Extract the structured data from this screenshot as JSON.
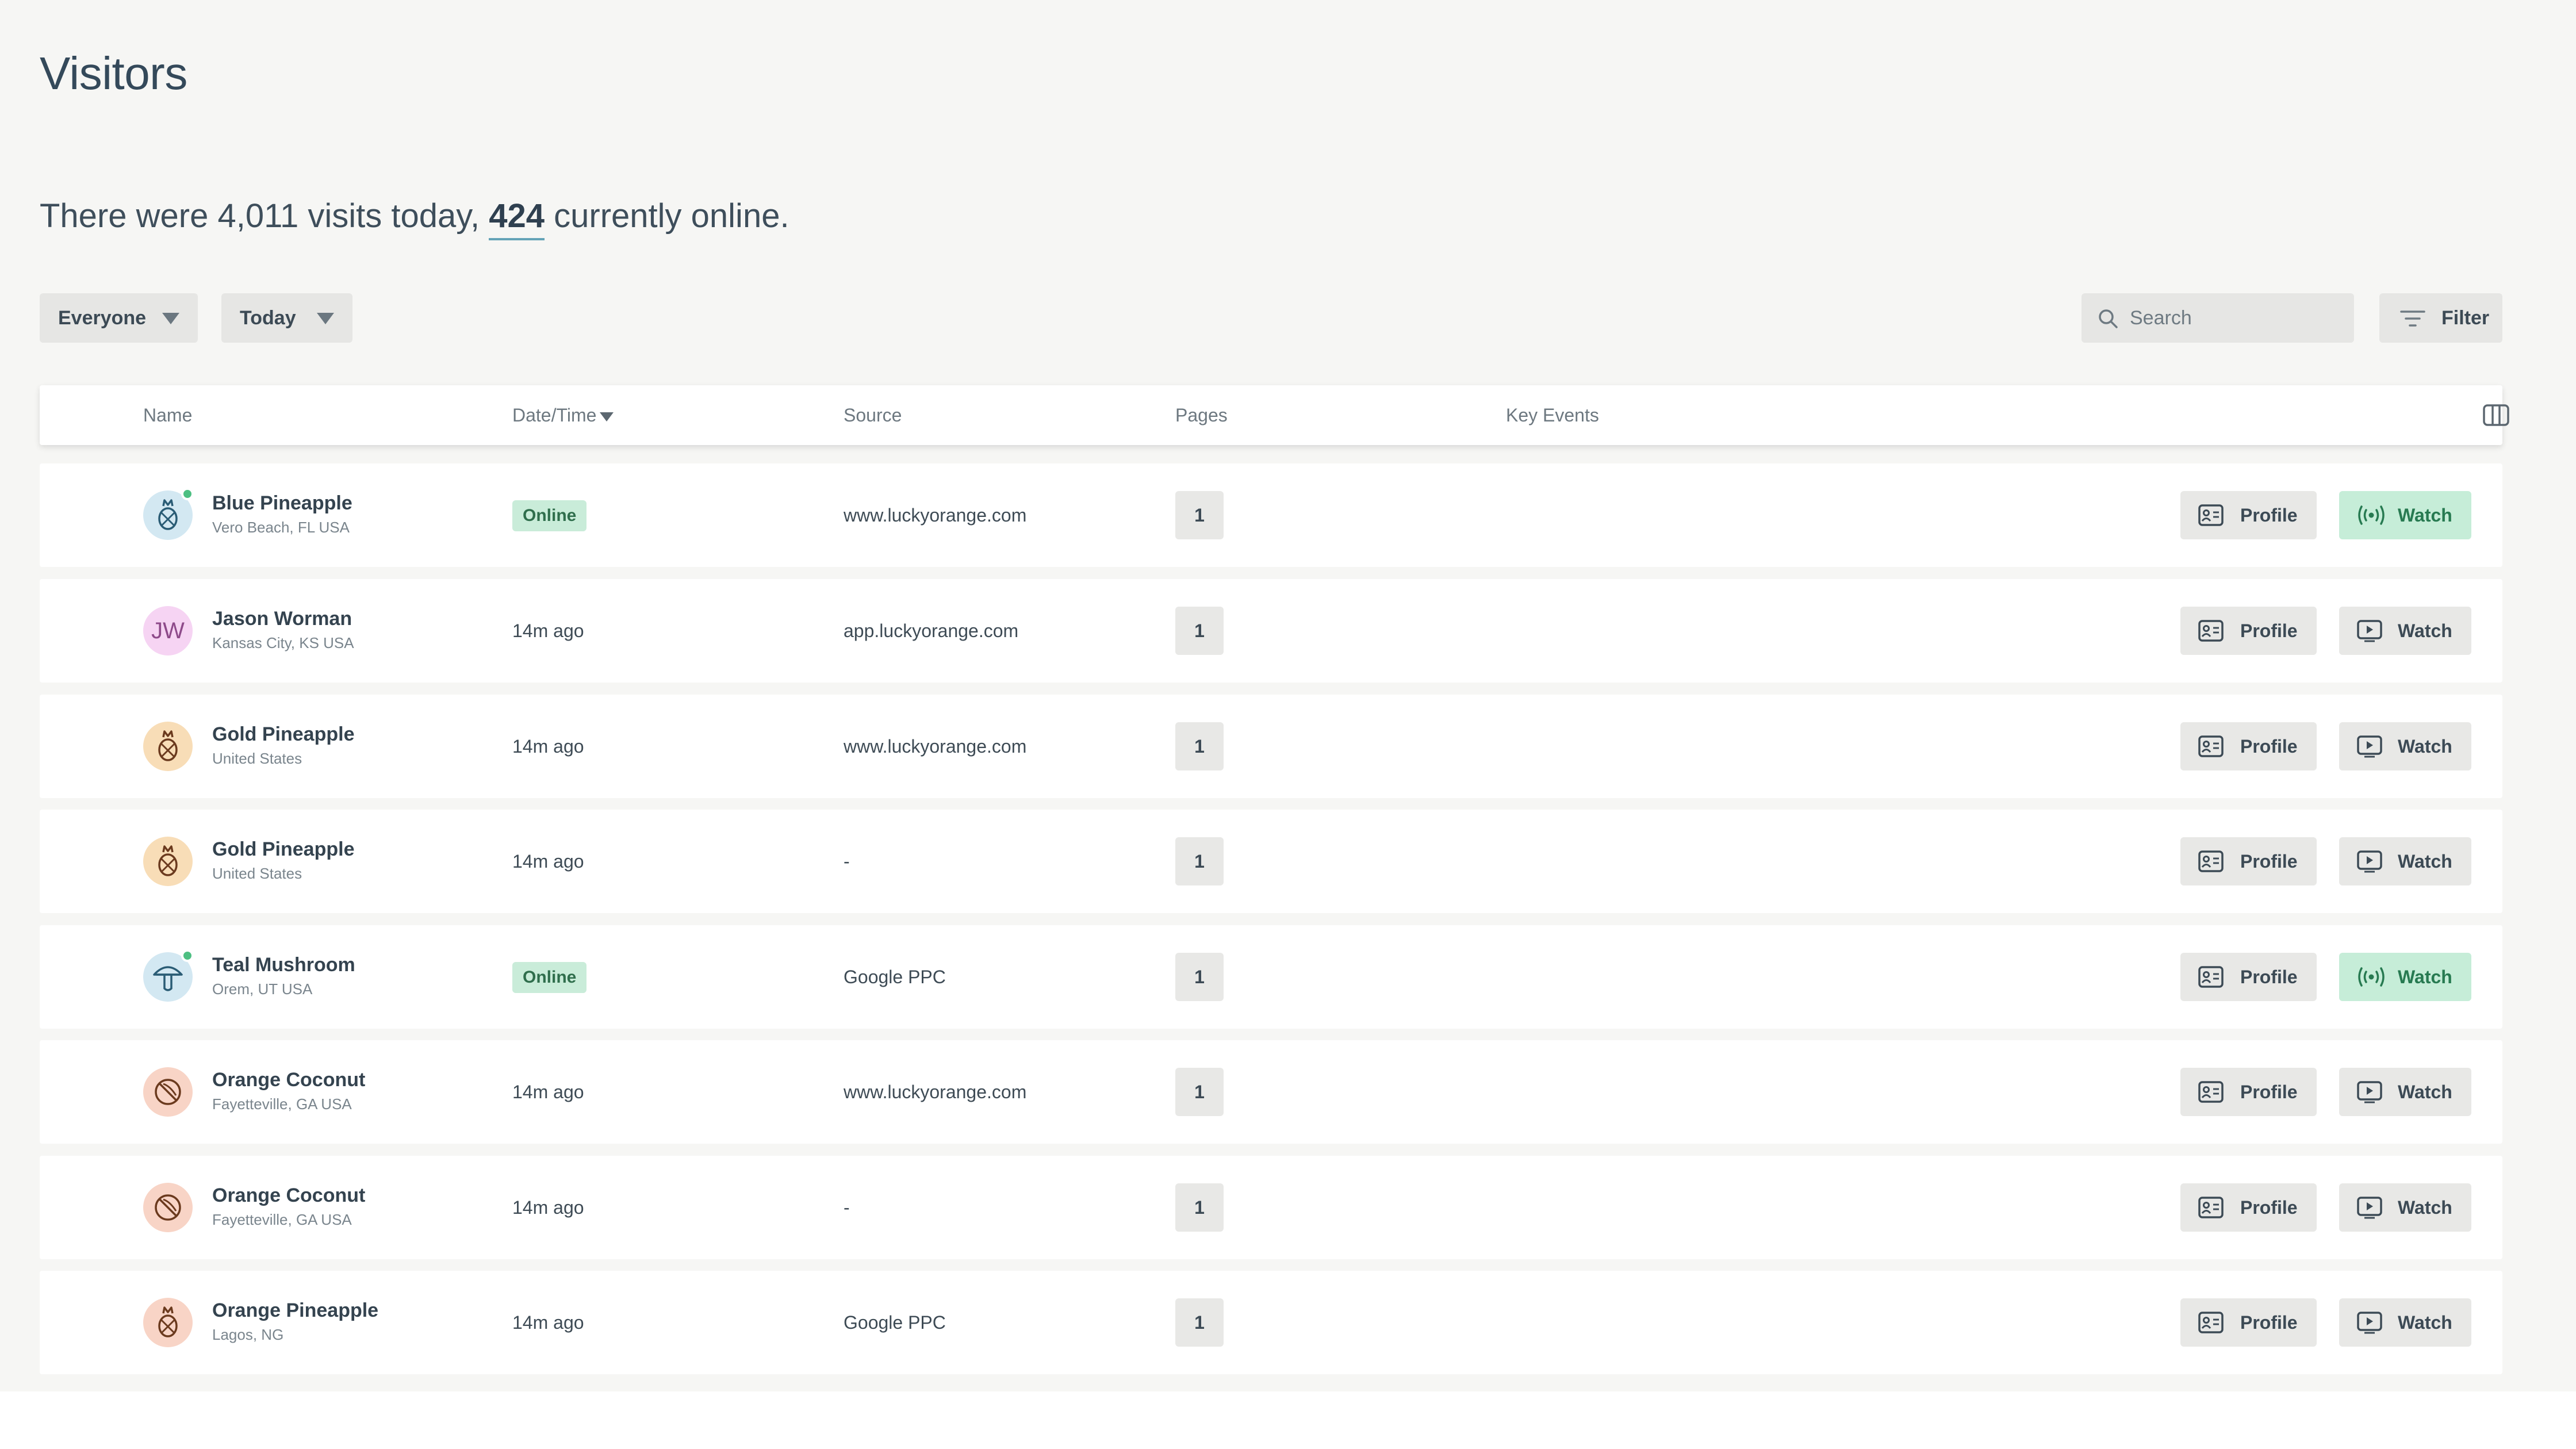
{
  "page": {
    "title": "Visitors"
  },
  "summary": {
    "prefix": "There were 4,011 visits today,",
    "online_count": "424",
    "suffix": "currently online."
  },
  "filters": {
    "audience": "Everyone",
    "range": "Today",
    "search_placeholder": "Search",
    "filter_label": "Filter"
  },
  "table": {
    "columns": {
      "name": "Name",
      "datetime": "Date/Time",
      "source": "Source",
      "pages": "Pages",
      "key_events": "Key Events"
    },
    "rows": [
      {
        "name": "Blue Pineapple",
        "location": "Vero Beach, FL USA",
        "time": "Online",
        "source": "www.luckyorange.com",
        "pages": "1",
        "profile": "Profile",
        "watch": "Watch"
      },
      {
        "name": "Jason Worman",
        "location": "Kansas City, KS USA",
        "initials": "JW",
        "time": "14m ago",
        "source": "app.luckyorange.com",
        "pages": "1",
        "profile": "Profile",
        "watch": "Watch"
      },
      {
        "name": "Gold Pineapple",
        "location": "United States",
        "time": "14m ago",
        "source": "www.luckyorange.com",
        "pages": "1",
        "profile": "Profile",
        "watch": "Watch"
      },
      {
        "name": "Gold Pineapple",
        "location": "United States",
        "time": "14m ago",
        "source": "-",
        "pages": "1",
        "profile": "Profile",
        "watch": "Watch"
      },
      {
        "name": "Teal Mushroom",
        "location": "Orem, UT USA",
        "time": "Online",
        "source": "Google PPC",
        "pages": "1",
        "profile": "Profile",
        "watch": "Watch"
      },
      {
        "name": "Orange Coconut",
        "location": "Fayetteville, GA USA",
        "time": "14m ago",
        "source": "www.luckyorange.com",
        "pages": "1",
        "profile": "Profile",
        "watch": "Watch"
      },
      {
        "name": "Orange Coconut",
        "location": "Fayetteville, GA USA",
        "time": "14m ago",
        "source": "-",
        "pages": "1",
        "profile": "Profile",
        "watch": "Watch"
      },
      {
        "name": "Orange Pineapple",
        "location": "Lagos, NG",
        "time": "14m ago",
        "source": "Google PPC",
        "pages": "1",
        "profile": "Profile",
        "watch": "Watch"
      }
    ]
  },
  "colors": {
    "online_badge_bg": "#c9ecd9",
    "live_watch_bg": "#c6edd8",
    "status_online": "#4dbf82",
    "page_bg": "#f6f6f4"
  },
  "icons": [
    "search-icon",
    "filter-icon",
    "columns-icon",
    "pineapple-icon",
    "mushroom-icon",
    "coconut-icon",
    "profile-card-icon",
    "play-icon",
    "broadcast-icon"
  ]
}
